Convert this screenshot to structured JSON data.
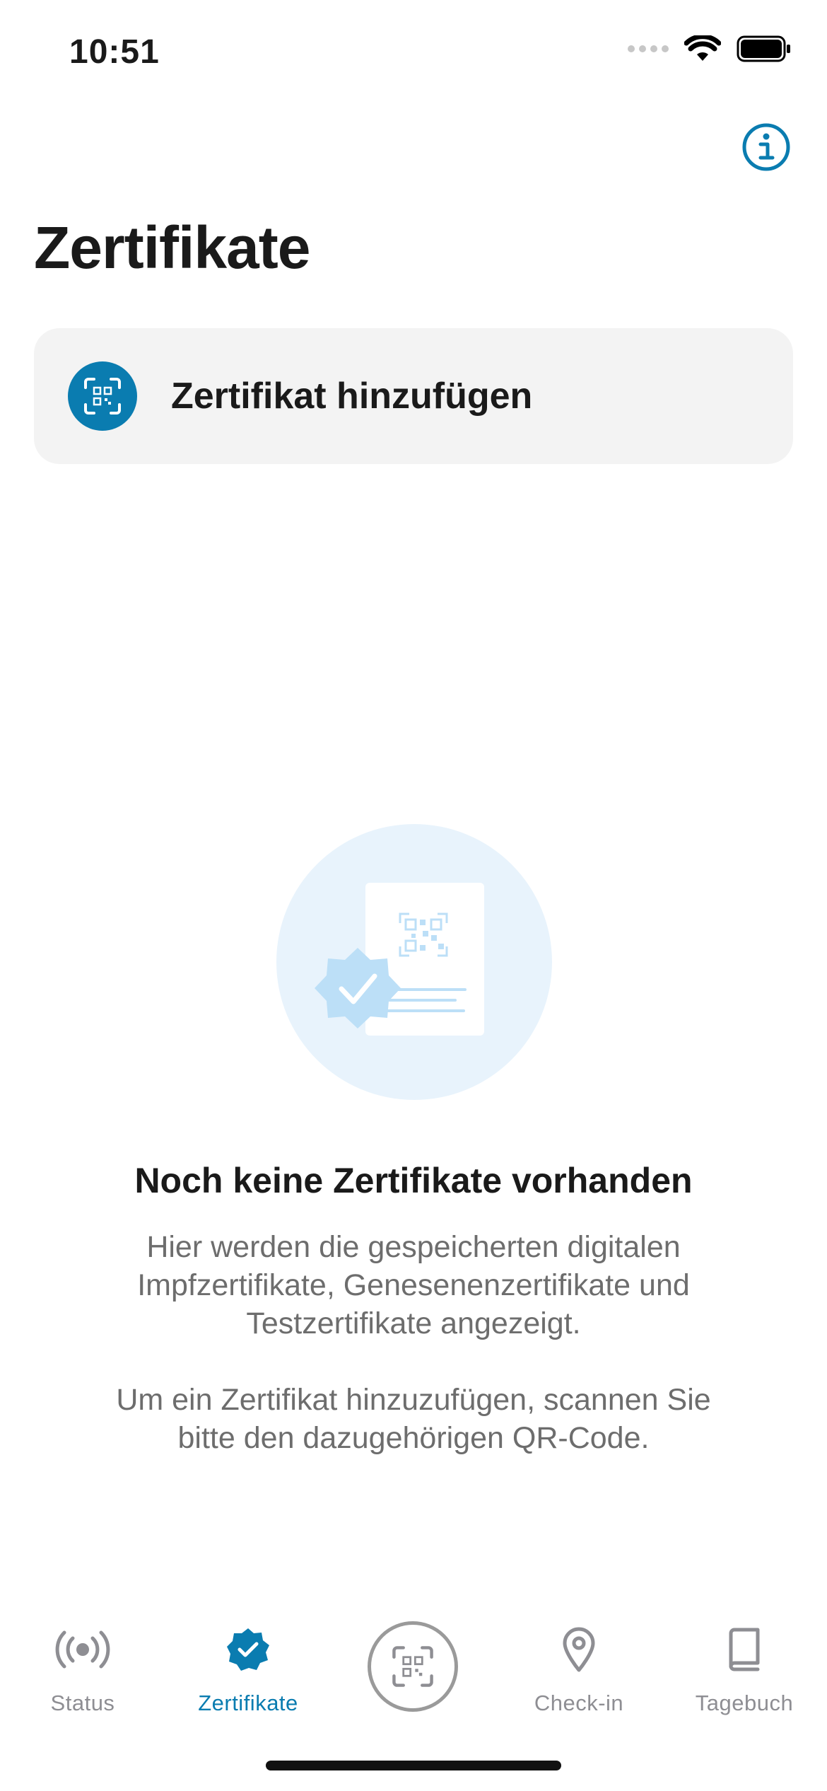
{
  "status_bar": {
    "time": "10:51",
    "icons": [
      "cellular-signal-icon",
      "wifi-icon",
      "battery-icon"
    ]
  },
  "header": {
    "info_icon": "info-icon",
    "title": "Zertifikate"
  },
  "add_certificate": {
    "icon": "qr-scan-icon",
    "label": "Zertifikat hinzufügen"
  },
  "empty_state": {
    "illustration": "certificate-illustration",
    "title": "Noch keine Zertifikate vorhanden",
    "paragraph_1": "Hier werden die gespeicherten digitalen Impfzertifikate, Genesenenzertifikate und Testzertifikate angezeigt.",
    "paragraph_2": "Um ein Zertifikat hinzuzufügen, scannen Sie bitte den dazugehörigen QR-Code."
  },
  "tab_bar": {
    "tabs": [
      {
        "label": "Status",
        "icon": "broadcast-icon",
        "active": false
      },
      {
        "label": "Zertifikate",
        "icon": "verified-badge-icon",
        "active": true
      },
      {
        "label": "",
        "icon": "qr-scan-icon",
        "active": false
      },
      {
        "label": "Check-in",
        "icon": "location-pin-icon",
        "active": false
      },
      {
        "label": "Tagebuch",
        "icon": "book-icon",
        "active": false
      }
    ]
  },
  "colors": {
    "accent": "#0a7cb0",
    "inactive": "#8e8e93",
    "card_background": "#f3f3f3",
    "illustration_light": "#e8f3fc",
    "illustration_badge": "#bcdff7"
  }
}
